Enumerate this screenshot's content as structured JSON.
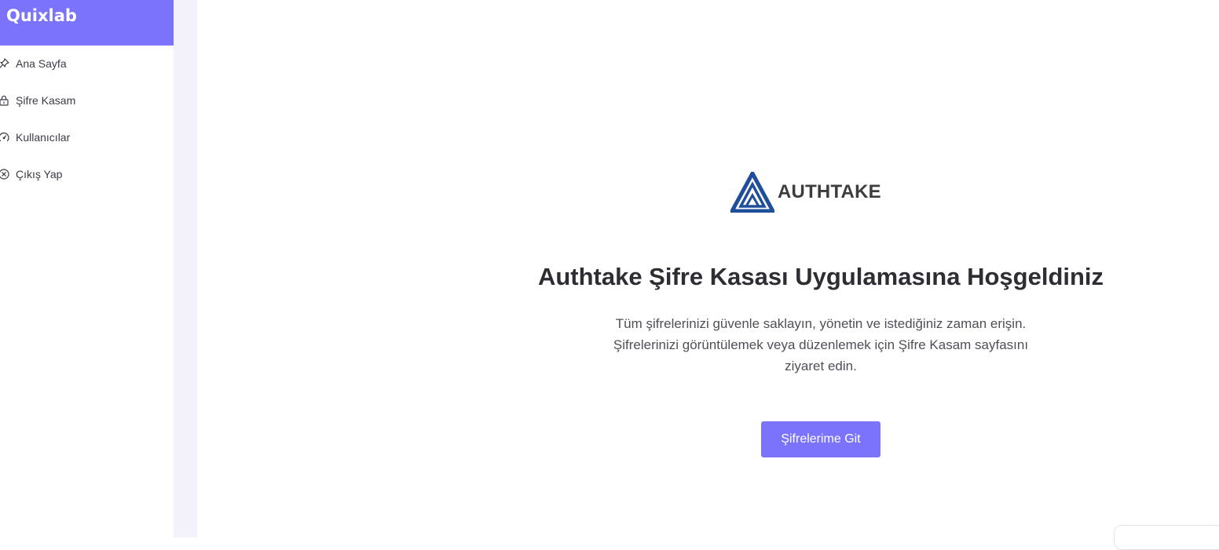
{
  "sidebar": {
    "brand": "Quixlab",
    "items": [
      {
        "label": "Ana Sayfa",
        "icon": "pin-icon"
      },
      {
        "label": "Şifre Kasam",
        "icon": "lock-icon"
      },
      {
        "label": "Kullanıcılar",
        "icon": "speedometer-icon"
      },
      {
        "label": "Çıkış Yap",
        "icon": "close-circle-icon"
      }
    ]
  },
  "main": {
    "logo_text": "AUTHTAKE",
    "title": "Authtake Şifre Kasası Uygulamasına Hoşgeldiniz",
    "description": "Tüm şifrelerinizi güvenle saklayın, yönetin ve istediğiniz zaman erişin. Şifrelerinizi görüntülemek veya düzenlemek için Şifre Kasam sayfasını ziyaret edin.",
    "button_label": "Şifrelerime Git"
  },
  "colors": {
    "accent": "#7b73fb",
    "logo_blue": "#1f4e9a",
    "gutter": "#f3f2fa"
  }
}
